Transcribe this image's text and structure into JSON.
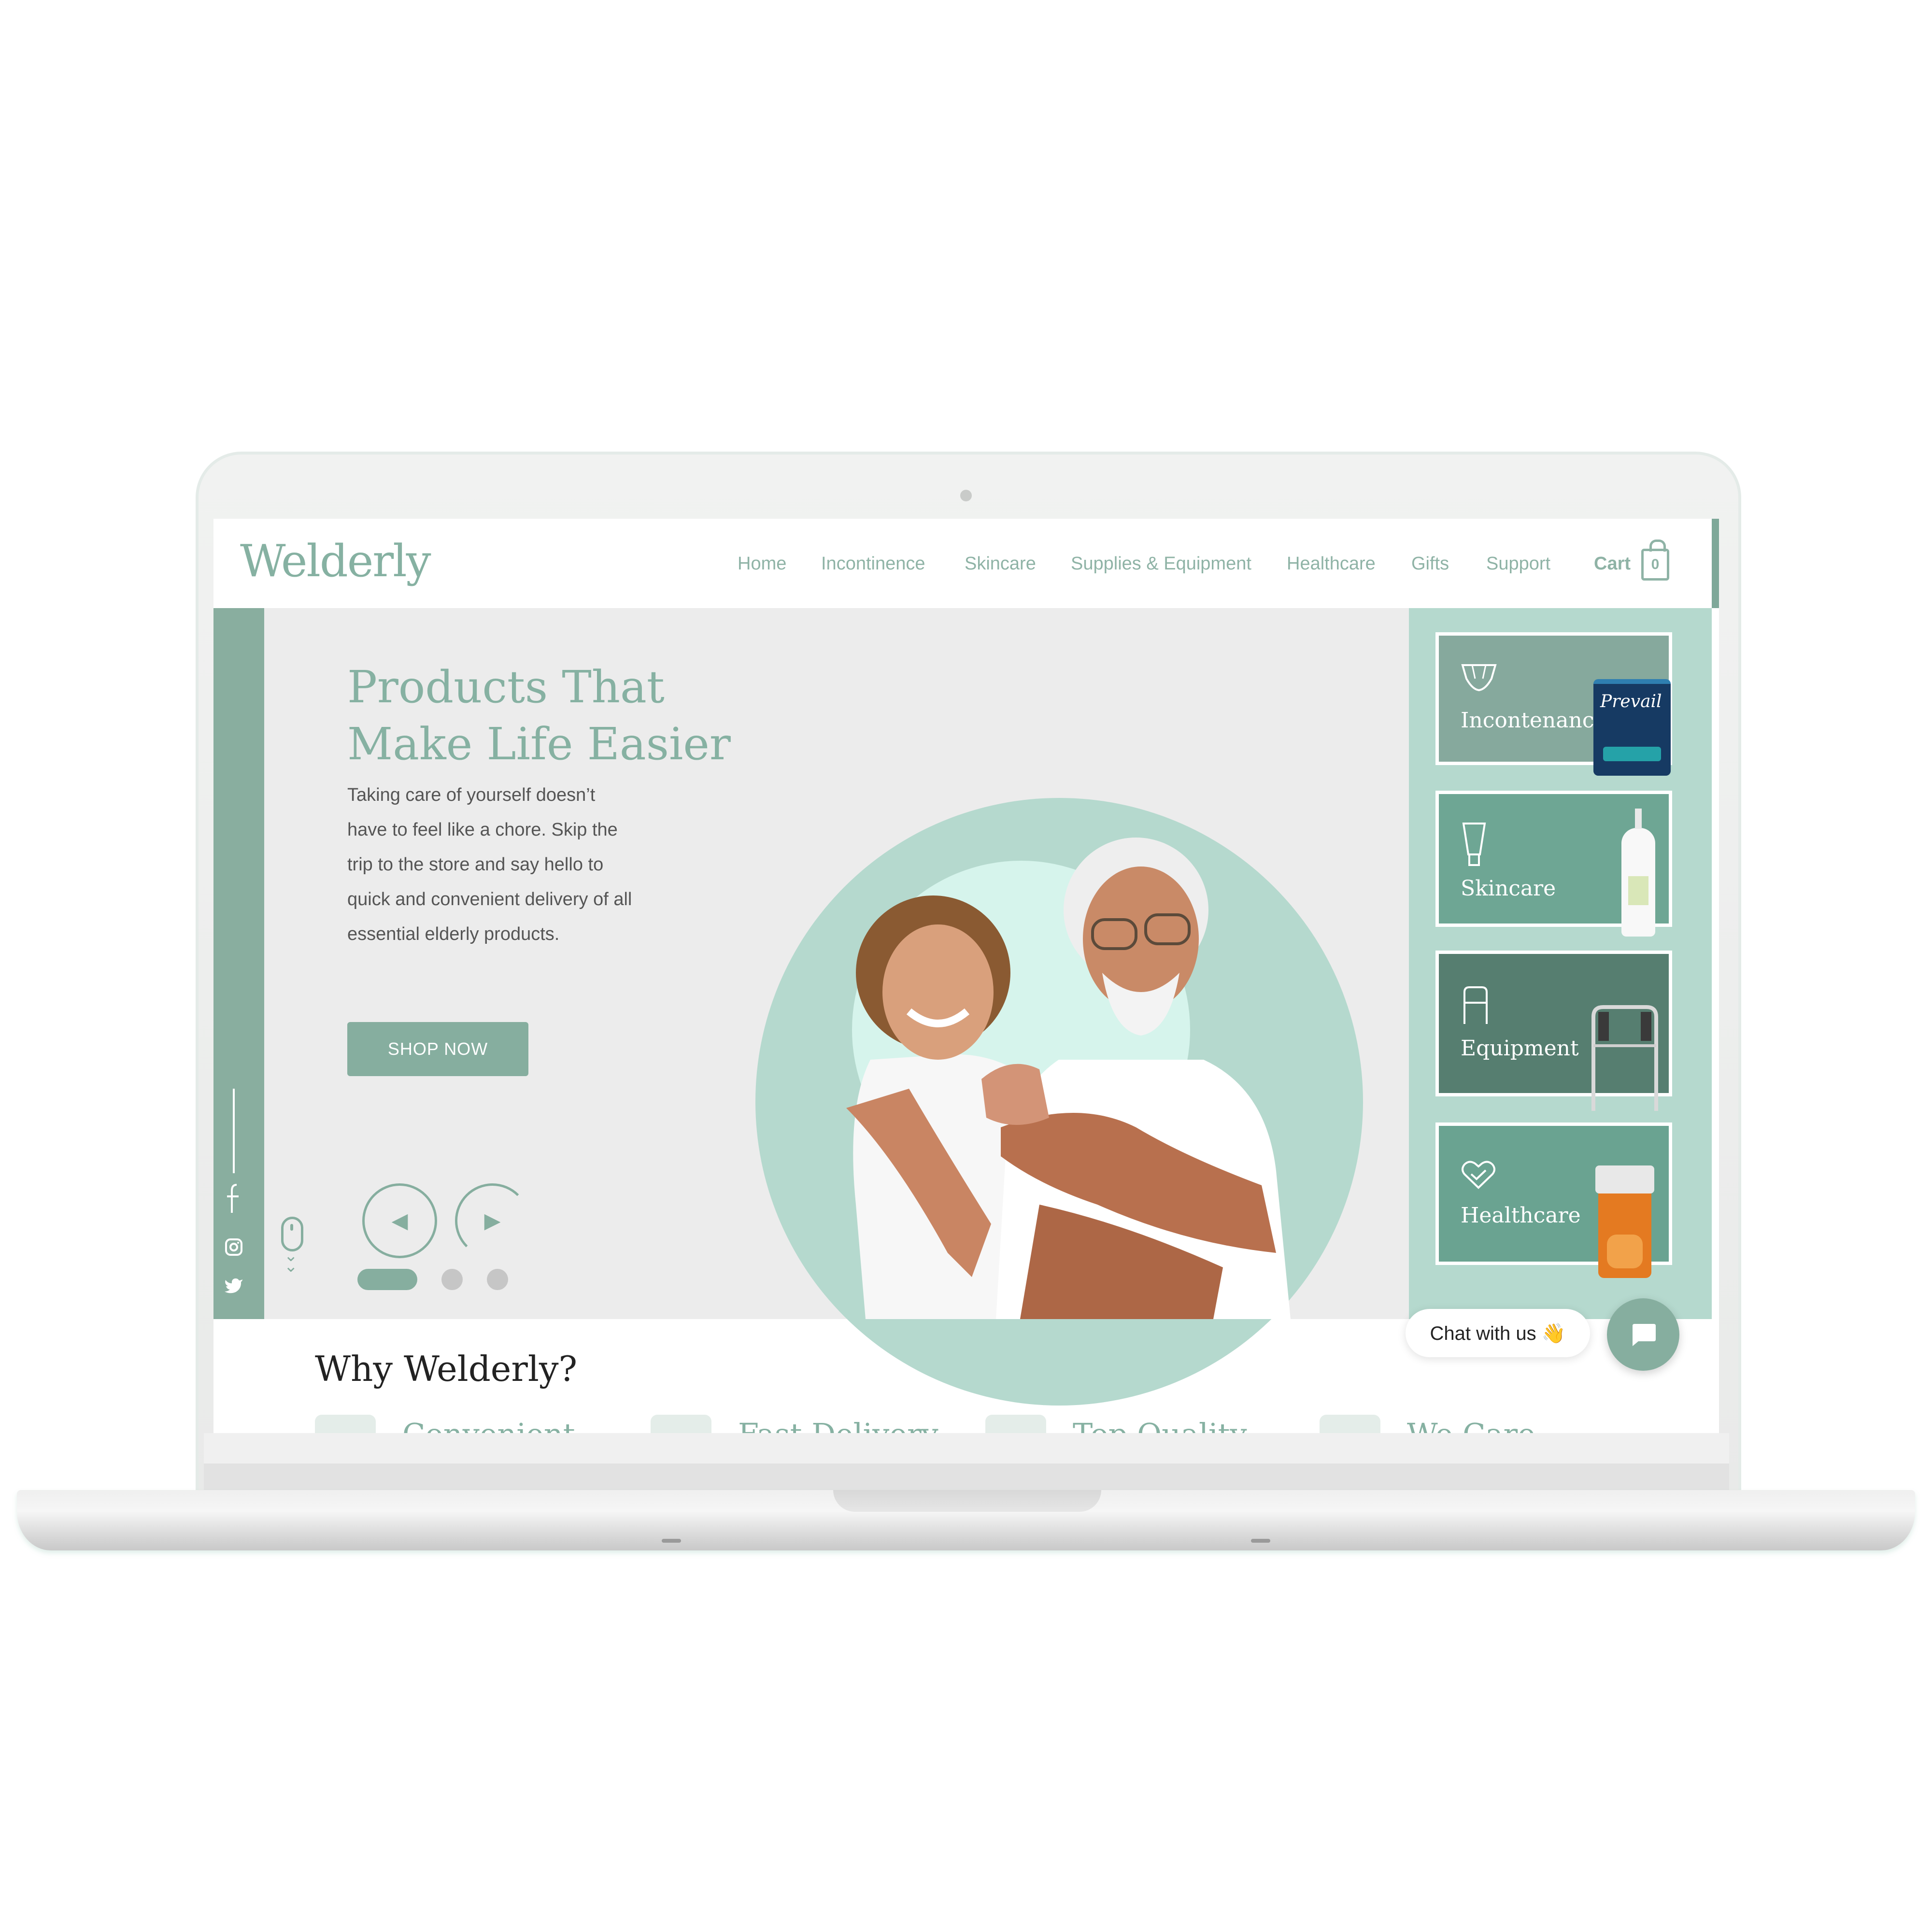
{
  "site": {
    "logo": "Welderly",
    "nav": [
      "Home",
      "Incontinence",
      "Skincare",
      "Supplies & Equipment",
      "Healthcare",
      "Gifts",
      "Support"
    ],
    "cart_label": "Cart",
    "cart_count": "0"
  },
  "hero": {
    "title_line1": "Products That",
    "title_line2": "Make Life Easier",
    "description": "Taking care of yourself doesn’t have to feel like a chore. Skip the trip to the store and say hello to quick and convenient delivery of all essential elderly products.",
    "cta": "SHOP NOW",
    "carousel_active_index": 0,
    "carousel_count": 3
  },
  "categories": [
    {
      "label": "Incontenance",
      "icon": "diaper-icon",
      "product_text": "Prevail",
      "color": "#86a99d"
    },
    {
      "label": "Skincare",
      "icon": "lotion-tube-icon",
      "color": "#6ea694"
    },
    {
      "label": "Equipment",
      "icon": "walker-icon",
      "color": "#567e70"
    },
    {
      "label": "Healthcare",
      "icon": "heart-icon",
      "color": "#6aa391"
    }
  ],
  "social": [
    "facebook-icon",
    "instagram-icon",
    "twitter-icon"
  ],
  "why": {
    "title": "Why Welderly?",
    "features": [
      "Convenient",
      "Fast Delivery",
      "Top Quality",
      "We Care"
    ]
  },
  "chat": {
    "label": "Chat with us 👋"
  },
  "colors": {
    "accent": "#86b1a2",
    "panel": "#b5d9ce",
    "hero_bg": "#ececec"
  }
}
